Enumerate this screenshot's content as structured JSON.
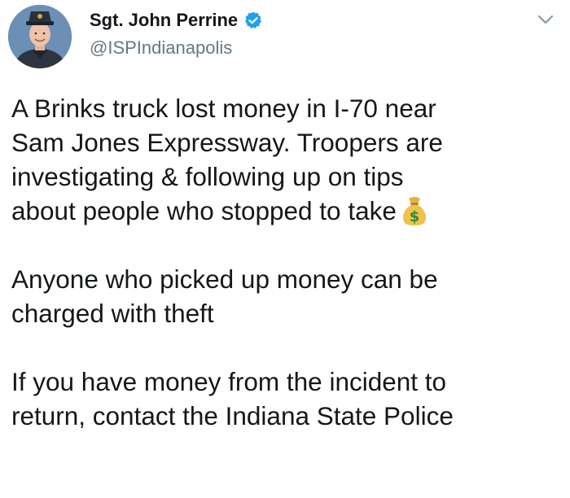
{
  "tweet": {
    "display_name": "Sgt. John Perrine",
    "handle": "@ISPIndianapolis",
    "verified_icon": "verified-badge-icon",
    "menu_icon": "chevron-down-icon",
    "avatar_icon": "profile-photo",
    "colors": {
      "verified": "#1da1f2",
      "handle": "#657786",
      "text": "#14171a"
    },
    "body": {
      "line1": "A Brinks truck lost money in I-70 near",
      "line2": "Sam Jones Expressway. Troopers are",
      "line3": "investigating & following up on tips",
      "line4": "about people who stopped to take",
      "line4_emoji": "money-bag-icon",
      "line5": "Anyone who picked up money can be",
      "line6": "charged with theft",
      "line7": "If you have money from the incident to",
      "line8": "return, contact the Indiana State Police"
    }
  }
}
